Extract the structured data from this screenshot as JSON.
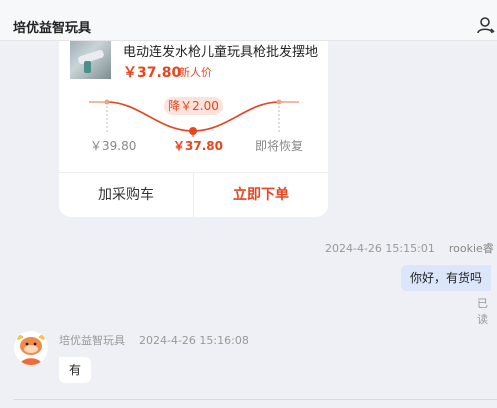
{
  "header": {
    "title": "培优益智玩具",
    "user_icon": "user-icon"
  },
  "product_card": {
    "name": "电动连发水枪儿童玩具枪批发摆地",
    "price": "￥37.80",
    "price_tag": "新人价",
    "drop_badge": "降￥2.00",
    "price_before": "￥39.80",
    "price_now": "￥37.80",
    "restore_label": "即将恢复",
    "add_to_cart": "加采购车",
    "buy_now": "立即下单",
    "accent_color": "#e8451f"
  },
  "messages": [
    {
      "time": "2024-4-26 15:15:01",
      "sender": "rookie睿",
      "text": "你好，有货吗",
      "status": "已读"
    },
    {
      "sender": "培优益智玩具",
      "time": "2024-4-26 15:16:08",
      "text": "有"
    }
  ]
}
